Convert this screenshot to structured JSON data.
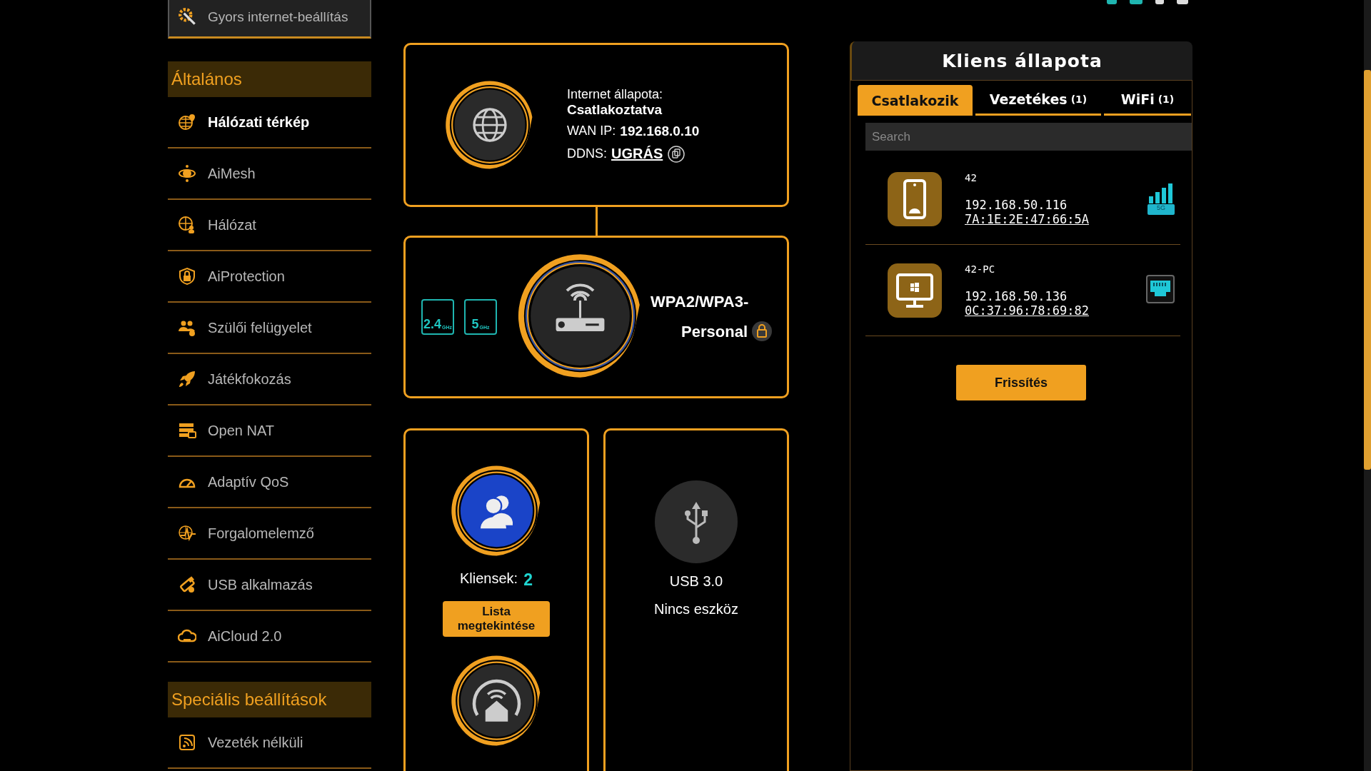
{
  "quick_setup": {
    "label": "Gyors internet-beállítás"
  },
  "sidebar": {
    "sections": [
      {
        "title": "Általános",
        "items": [
          {
            "label": "Hálózati térkép",
            "kind": "globe-pin",
            "selected": true
          },
          {
            "label": "AiMesh",
            "kind": "mesh",
            "selected": false
          },
          {
            "label": "Hálózat",
            "kind": "globe",
            "selected": false
          },
          {
            "label": "AiProtection",
            "kind": "shield",
            "selected": false
          },
          {
            "label": "Szülői felügyelet",
            "kind": "people",
            "selected": false
          },
          {
            "label": "Játékfokozás",
            "kind": "rocket",
            "selected": false
          },
          {
            "label": "Open NAT",
            "kind": "server",
            "selected": false
          },
          {
            "label": "Adaptív QoS",
            "kind": "gauge",
            "selected": false
          },
          {
            "label": "Forgalomelemző",
            "kind": "pulse",
            "selected": false
          },
          {
            "label": "USB alkalmazás",
            "kind": "usb",
            "selected": false
          },
          {
            "label": "AiCloud 2.0",
            "kind": "cloud",
            "selected": false
          }
        ]
      },
      {
        "title": "Speciális beállítások",
        "items": [
          {
            "label": "Vezeték nélküli",
            "kind": "wifi",
            "selected": false
          }
        ]
      }
    ]
  },
  "network_map": {
    "internet": {
      "status_label": "Internet állapota:",
      "status": "Csatlakoztatva",
      "wan_label": "WAN IP:",
      "wan_ip": "192.168.0.10",
      "ddns_label": "DDNS:",
      "ddns_link": "UGRÁS"
    },
    "router": {
      "bands": [
        {
          "value": "2.4",
          "unit": "GHz"
        },
        {
          "value": "5",
          "unit": "GHz"
        }
      ],
      "security": "WPA2/WPA3-Personal"
    },
    "clients": {
      "label": "Kliensek:",
      "count": "2",
      "button": "Lista megtekintése"
    },
    "usb": {
      "title": "USB 3.0",
      "status": "Nincs eszköz"
    }
  },
  "client_status": {
    "title": "Kliens állapota",
    "tabs": [
      {
        "label": "Csatlakozik",
        "selected": true
      },
      {
        "label": "Vezetékes",
        "count": "(1)",
        "selected": false
      },
      {
        "label": "WiFi",
        "count": "(1)",
        "selected": false
      }
    ],
    "search": {
      "placeholder": "Search"
    },
    "clients": [
      {
        "name": "42",
        "ip": "192.168.50.116",
        "mac": "7A:1E:2E:47:66:5A",
        "kind": "phone",
        "band": "5G"
      },
      {
        "name": "42-PC",
        "ip": "192.168.50.136",
        "mac": "0C:37:96:78:69:82",
        "kind": "pc"
      }
    ],
    "refresh_button": "Frissítés"
  }
}
